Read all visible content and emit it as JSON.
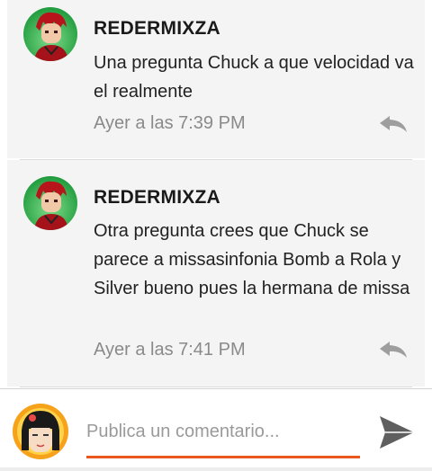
{
  "comments": [
    {
      "author": "REDERMIXZA",
      "text": "Una pregunta Chuck a que velocidad va el realmente",
      "time": "Ayer a las 7:39 PM"
    },
    {
      "author": "REDERMIXZA",
      "text": "Otra pregunta crees que Chuck se parece a missasinfonia Bomb a Rola y Silver bueno pues la hermana de missa",
      "time": "Ayer a las 7:41 PM"
    }
  ],
  "composer": {
    "placeholder": "Publica un comentario..."
  },
  "icons": {
    "reply": "reply-arrow-icon",
    "send": "send-paper-plane-icon"
  },
  "colors": {
    "accent": "#e8581c",
    "card_bg": "#f4f4f4",
    "muted_text": "#8a8a8a"
  }
}
